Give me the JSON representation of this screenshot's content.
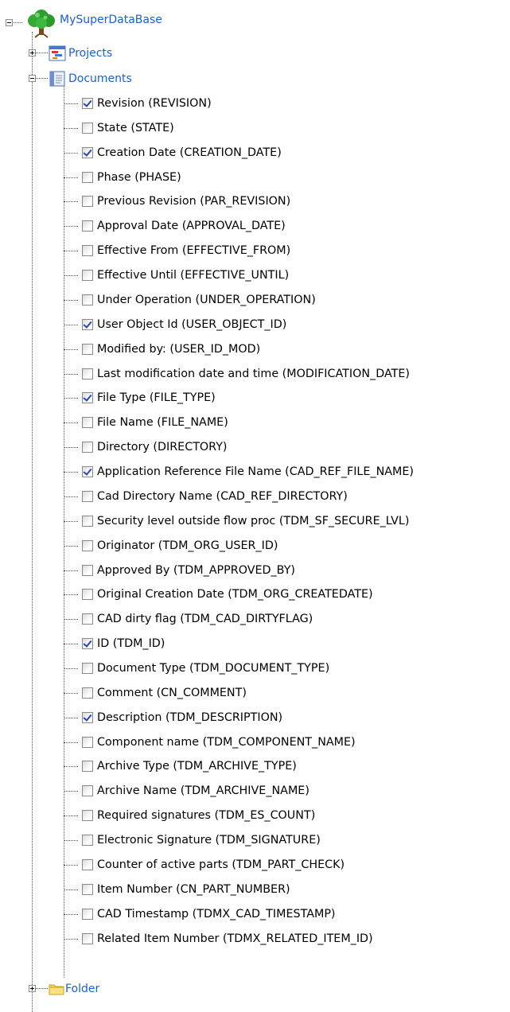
{
  "root": {
    "label": "MySuperDataBase",
    "icon": "tree-database-icon",
    "expanded": true
  },
  "nodes": {
    "projects": {
      "label": "Projects",
      "icon": "projects-chart-icon",
      "expanded": false
    },
    "documents": {
      "label": "Documents",
      "icon": "document-icon",
      "expanded": true
    },
    "folder": {
      "label": "Folder",
      "icon": "folder-icon",
      "expanded": false
    }
  },
  "fields": [
    {
      "label": "Revision (REVISION)",
      "checked": true
    },
    {
      "label": "State (STATE)",
      "checked": false
    },
    {
      "label": "Creation Date (CREATION_DATE)",
      "checked": true
    },
    {
      "label": "Phase (PHASE)",
      "checked": false
    },
    {
      "label": "Previous Revision (PAR_REVISION)",
      "checked": false
    },
    {
      "label": "Approval Date (APPROVAL_DATE)",
      "checked": false
    },
    {
      "label": "Effective From (EFFECTIVE_FROM)",
      "checked": false
    },
    {
      "label": "Effective Until (EFFECTIVE_UNTIL)",
      "checked": false
    },
    {
      "label": "Under Operation (UNDER_OPERATION)",
      "checked": false
    },
    {
      "label": "User Object Id (USER_OBJECT_ID)",
      "checked": true
    },
    {
      "label": "Modified by: (USER_ID_MOD)",
      "checked": false
    },
    {
      "label": "Last modification date and time (MODIFICATION_DATE)",
      "checked": false
    },
    {
      "label": "File Type (FILE_TYPE)",
      "checked": true
    },
    {
      "label": "File Name (FILE_NAME)",
      "checked": false
    },
    {
      "label": "Directory (DIRECTORY)",
      "checked": false
    },
    {
      "label": "Application Reference File Name (CAD_REF_FILE_NAME)",
      "checked": true
    },
    {
      "label": "Cad Directory Name (CAD_REF_DIRECTORY)",
      "checked": false
    },
    {
      "label": "Security level outside flow proc (TDM_SF_SECURE_LVL)",
      "checked": false
    },
    {
      "label": "Originator (TDM_ORG_USER_ID)",
      "checked": false
    },
    {
      "label": "Approved By (TDM_APPROVED_BY)",
      "checked": false
    },
    {
      "label": "Original Creation Date (TDM_ORG_CREATEDATE)",
      "checked": false
    },
    {
      "label": "CAD dirty flag (TDM_CAD_DIRTYFLAG)",
      "checked": false
    },
    {
      "label": "ID (TDM_ID)",
      "checked": true
    },
    {
      "label": "Document Type (TDM_DOCUMENT_TYPE)",
      "checked": false
    },
    {
      "label": "Comment (CN_COMMENT)",
      "checked": false
    },
    {
      "label": "Description (TDM_DESCRIPTION)",
      "checked": true
    },
    {
      "label": "Component name (TDM_COMPONENT_NAME)",
      "checked": false
    },
    {
      "label": "Archive Type (TDM_ARCHIVE_TYPE)",
      "checked": false
    },
    {
      "label": "Archive Name (TDM_ARCHIVE_NAME)",
      "checked": false
    },
    {
      "label": "Required signatures (TDM_ES_COUNT)",
      "checked": false
    },
    {
      "label": "Electronic Signature (TDM_SIGNATURE)",
      "checked": false
    },
    {
      "label": "Counter of active parts (TDM_PART_CHECK)",
      "checked": false
    },
    {
      "label": "Item Number (CN_PART_NUMBER)",
      "checked": false
    },
    {
      "label": "CAD Timestamp (TDMX_CAD_TIMESTAMP)",
      "checked": false
    },
    {
      "label": "Related Item Number (TDMX_RELATED_ITEM_ID)",
      "checked": false
    }
  ]
}
